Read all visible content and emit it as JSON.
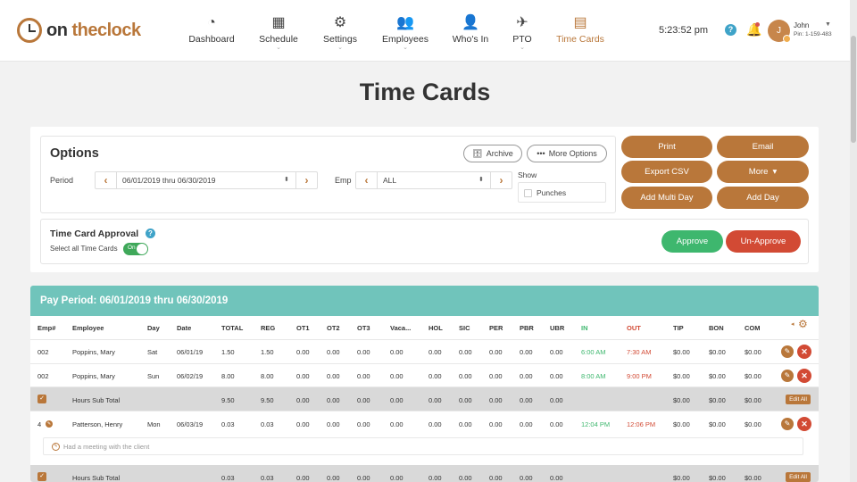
{
  "app": {
    "logo_on": "on",
    "logo_the": "the",
    "logo_clock": "clock"
  },
  "nav": [
    {
      "label": "Dashboard",
      "icon": "dashboard-icon",
      "glyph": "◔",
      "caret": ""
    },
    {
      "label": "Schedule",
      "icon": "calendar-icon",
      "glyph": "▦",
      "caret": "⌄"
    },
    {
      "label": "Settings",
      "icon": "gear-icon",
      "glyph": "⚙",
      "caret": "⌄"
    },
    {
      "label": "Employees",
      "icon": "people-icon",
      "glyph": "👥",
      "caret": "⌄"
    },
    {
      "label": "Who's In",
      "icon": "person-clock-icon",
      "glyph": "👤",
      "caret": ""
    },
    {
      "label": "PTO",
      "icon": "plane-icon",
      "glyph": "✈",
      "caret": "⌄"
    },
    {
      "label": "Time Cards",
      "icon": "timecard-icon",
      "glyph": "▤",
      "caret": ""
    }
  ],
  "header": {
    "time": "5:23:52 pm",
    "help": "?",
    "avatar_initial": "J",
    "user_name": "John",
    "user_pin": "Pin: 1-159-483"
  },
  "page": {
    "title": "Time Cards"
  },
  "options": {
    "title": "Options",
    "archive_label": "Archive",
    "more_options_label": "More Options",
    "period_label": "Period",
    "period_value": "06/01/2019 thru 06/30/2019",
    "emp_label": "Emp",
    "emp_value": "ALL",
    "show_label": "Show",
    "punches_label": "Punches",
    "prev": "‹",
    "next": "›",
    "updown": "⬍"
  },
  "actions": {
    "print": "Print",
    "email": "Email",
    "export_csv": "Export CSV",
    "more": "More",
    "more_caret": "▾",
    "add_multi_day": "Add Multi Day",
    "add_day": "Add Day"
  },
  "approval": {
    "title": "Time Card Approval",
    "help": "?",
    "select_all_label": "Select all Time Cards",
    "toggle_label": "On",
    "approve": "Approve",
    "unapprove": "Un-Approve"
  },
  "table": {
    "pay_period_title": "Pay Period: 06/01/2019 thru 06/30/2019",
    "headers": [
      "Emp#",
      "Employee",
      "Day",
      "Date",
      "TOTAL",
      "REG",
      "OT1",
      "OT2",
      "OT3",
      "Vaca...",
      "HOL",
      "SIC",
      "PER",
      "PBR",
      "UBR",
      "IN",
      "OUT",
      "TIP",
      "BON",
      "COM"
    ],
    "rows": [
      {
        "emp": "002",
        "name": "Poppins, Mary",
        "day": "Sat",
        "date": "06/01/19",
        "total": "1.50",
        "reg": "1.50",
        "ot1": "0.00",
        "ot2": "0.00",
        "ot3": "0.00",
        "vac": "0.00",
        "hol": "0.00",
        "sic": "0.00",
        "per": "0.00",
        "pbr": "0.00",
        "ubr": "0.00",
        "in": "6:00 AM",
        "out": "7:30 AM",
        "tip": "$0.00",
        "bon": "$0.00",
        "com": "$0.00"
      },
      {
        "emp": "002",
        "name": "Poppins, Mary",
        "day": "Sun",
        "date": "06/02/19",
        "total": "8.00",
        "reg": "8.00",
        "ot1": "0.00",
        "ot2": "0.00",
        "ot3": "0.00",
        "vac": "0.00",
        "hol": "0.00",
        "sic": "0.00",
        "per": "0.00",
        "pbr": "0.00",
        "ubr": "0.00",
        "in": "8:00 AM",
        "out": "9:00 PM",
        "tip": "$0.00",
        "bon": "$0.00",
        "com": "$0.00"
      }
    ],
    "subtotal_1": {
      "label": "Hours Sub Total",
      "total": "9.50",
      "reg": "9.50",
      "ot1": "0.00",
      "ot2": "0.00",
      "ot3": "0.00",
      "vac": "0.00",
      "hol": "0.00",
      "sic": "0.00",
      "per": "0.00",
      "pbr": "0.00",
      "ubr": "0.00",
      "tip": "$0.00",
      "bon": "$0.00",
      "com": "$0.00",
      "edit_all": "Edit All"
    },
    "row3": {
      "emp": "4",
      "name": "Patterson, Henry",
      "day": "Mon",
      "date": "06/03/19",
      "total": "0.03",
      "reg": "0.03",
      "ot1": "0.00",
      "ot2": "0.00",
      "ot3": "0.00",
      "vac": "0.00",
      "hol": "0.00",
      "sic": "0.00",
      "per": "0.00",
      "pbr": "0.00",
      "ubr": "0.00",
      "in": "12:04 PM",
      "out": "12:06 PM",
      "tip": "$0.00",
      "bon": "$0.00",
      "com": "$0.00"
    },
    "note": "Had a meeting with the client",
    "subtotal_2": {
      "label": "Hours Sub Total",
      "total": "0.03",
      "reg": "0.03",
      "ot1": "0.00",
      "ot2": "0.00",
      "ot3": "0.00",
      "vac": "0.00",
      "hol": "0.00",
      "sic": "0.00",
      "per": "0.00",
      "pbr": "0.00",
      "ubr": "0.00",
      "tip": "$0.00",
      "bon": "$0.00",
      "com": "$0.00",
      "edit_all": "Edit All"
    }
  },
  "colors": {
    "brand": "#b9773a",
    "teal": "#70c4bb",
    "approve": "#3eb76e",
    "unapprove": "#d24a34",
    "info": "#3fa3c8"
  }
}
